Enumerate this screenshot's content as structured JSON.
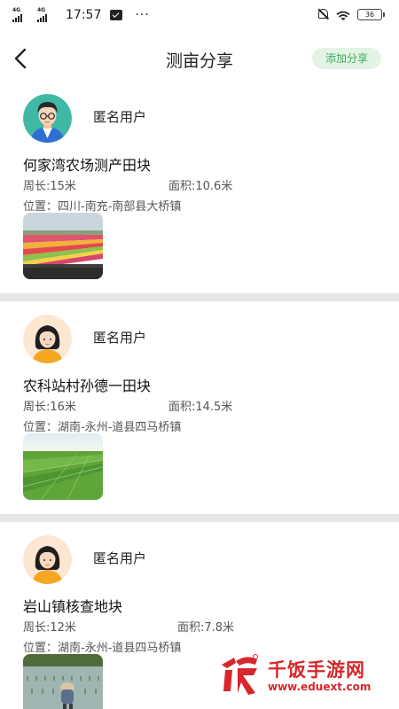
{
  "status_bar": {
    "network_1": "4G",
    "network_2": "4G",
    "time": "17:57",
    "more": "···",
    "battery": "36",
    "icons": [
      "signal-icon",
      "signal-icon",
      "message-icon",
      "mute-icon",
      "wifi-icon",
      "battery-icon"
    ]
  },
  "header": {
    "title": "测亩分享",
    "add_button": "添加分享",
    "back_icon": "chevron-left-icon"
  },
  "colors": {
    "accent_green": "#3ea85b",
    "accent_green_bg": "#e3f4e6",
    "divider": "#e6e6e6",
    "watermark_red": "#d8262b"
  },
  "posts": [
    {
      "user": "匿名用户",
      "avatar": "male-avatar",
      "title": "何家湾农场测产田块",
      "perimeter": "周长:15米",
      "area": "面积:10.6米",
      "location": "位置：四川-南充-南部县大桥镇",
      "image": "flower-field-photo"
    },
    {
      "user": "匿名用户",
      "avatar": "female-avatar",
      "title": "农科站村孙德一田块",
      "perimeter": "周长:16米",
      "area": "面积:14.5米",
      "location": "位置：湖南-永州-道县四马桥镇",
      "image": "green-paddy-photo"
    },
    {
      "user": "匿名用户",
      "avatar": "female-avatar",
      "title": "岩山镇核查地块",
      "perimeter": "周长:12米",
      "area": "面积:7.8米",
      "location": "位置：湖南-永州-道县四马桥镇",
      "image": "rice-planting-photo"
    }
  ],
  "watermark": {
    "text": "千饭手游网",
    "url": "www.eduext.com"
  }
}
